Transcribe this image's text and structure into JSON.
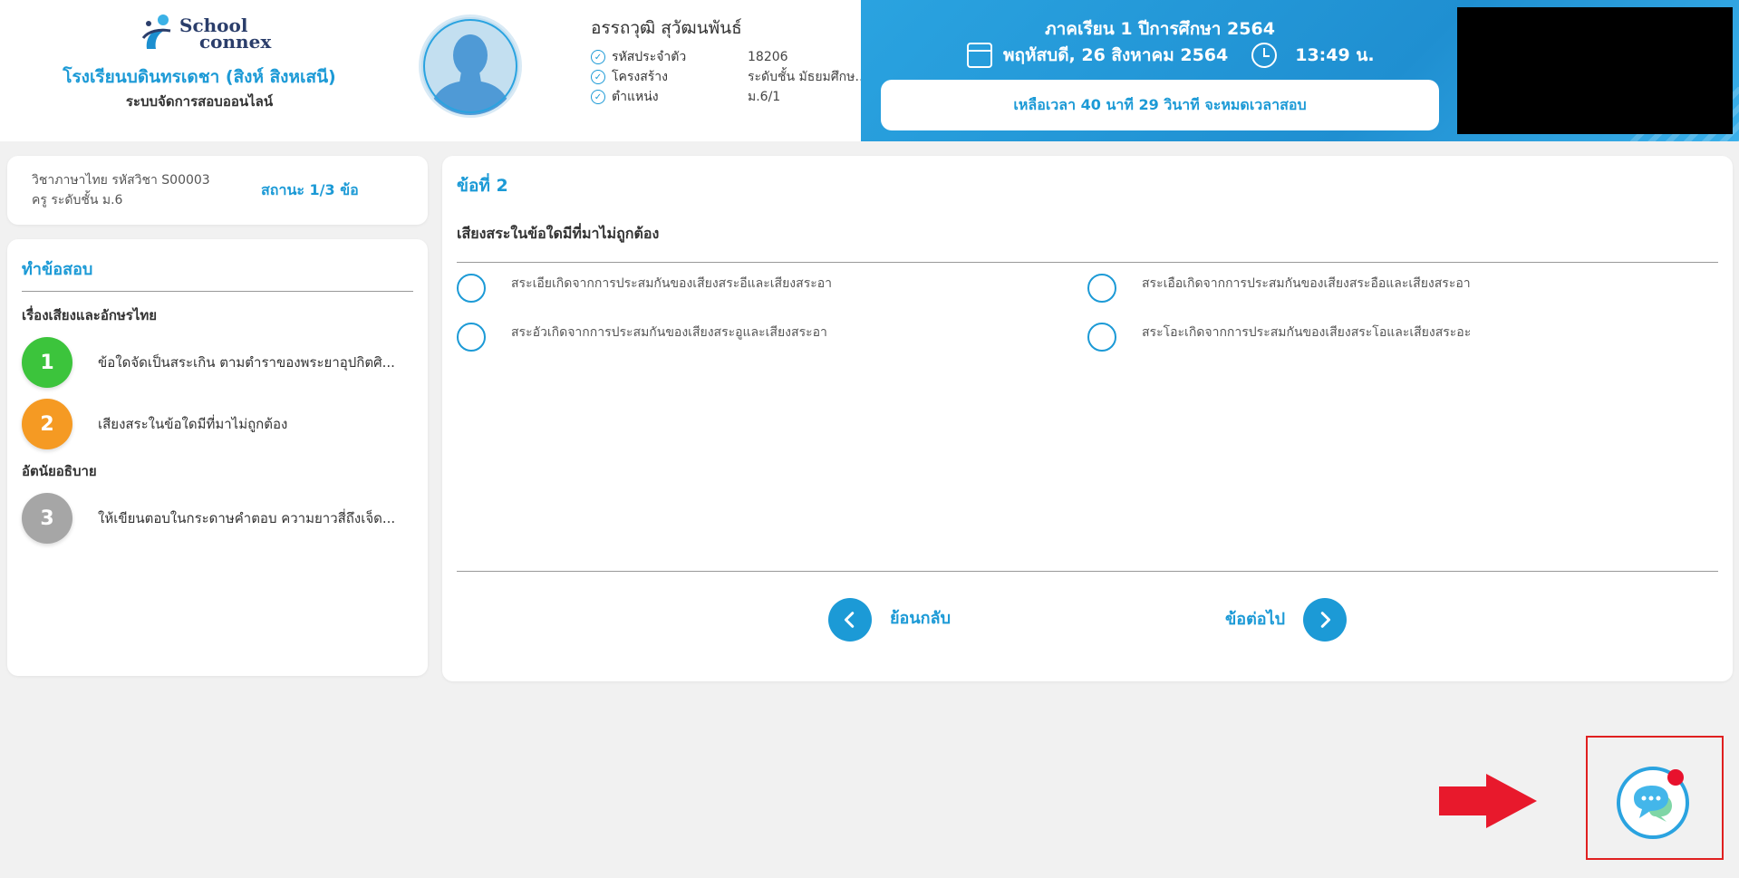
{
  "header": {
    "logo_line1": "School",
    "logo_line2": "connex",
    "school_name": "โรงเรียนบดินทรเดชา (สิงห์ สิงหเสนี)",
    "system_name": "ระบบจัดการสอบออนไลน์",
    "student": {
      "name": "อรรถวุฒิ สุวัฒนพันธ์",
      "rows": [
        {
          "label": "รหัสประจำตัว",
          "value": "18206"
        },
        {
          "label": "โครงสร้าง",
          "value": "ระดับชั้น มัธยมศึกษา..."
        },
        {
          "label": "ตำแหน่ง",
          "value": "ม.6/1"
        }
      ]
    },
    "term": "ภาคเรียน 1 ปีการศึกษา 2564",
    "date": "พฤหัสบดี, 26 สิงหาคม 2564",
    "time": "13:49 น.",
    "remaining": "เหลือเวลา 40 นาที 29 วินาที จะหมดเวลาสอบ"
  },
  "subject": {
    "line1": "วิชาภาษาไทย รหัสวิชา S00003",
    "line2": "ครู ระดับชั้น ม.6",
    "status": "สถานะ 1/3 ข้อ"
  },
  "nav": {
    "title": "ทำข้อสอบ",
    "sections": [
      {
        "label": "เรื่องเสียงและอักษรไทย"
      },
      {
        "label": "อัตนัยอธิบาย"
      }
    ],
    "items": [
      {
        "num": "1",
        "text": "ข้อใดจัดเป็นสระเกิน ตามตำราของพระยาอุปกิตศิ...",
        "color": "#3cc43c"
      },
      {
        "num": "2",
        "text": "เสียงสระในข้อใดมีที่มาไม่ถูกต้อง",
        "color": "#f59a23"
      },
      {
        "num": "3",
        "text": "ให้เขียนตอบในกระดาษคำตอบ ความยาวสี่ถึงเจ็ด...",
        "color": "#a6a6a6"
      }
    ]
  },
  "question": {
    "heading": "ข้อที่ 2",
    "text": "เสียงสระในข้อใดมีที่มาไม่ถูกต้อง",
    "options": [
      "สระเอียเกิดจากการประสมกันของเสียงสระอีและเสียงสระอา",
      "สระเอือเกิดจากการประสมกันของเสียงสระอือและเสียงสระอา",
      "สระอัวเกิดจากการประสมกันของเสียงสระอูและเสียงสระอา",
      "สระโอะเกิดจากการประสมกันของเสียงสระโอและเสียงสระอะ"
    ],
    "prev_label": "ย้อนกลับ",
    "next_label": "ข้อต่อไป"
  },
  "colors": {
    "accent": "#1c9ad6",
    "highlight": "#e02020",
    "notification": "#e8112d"
  }
}
